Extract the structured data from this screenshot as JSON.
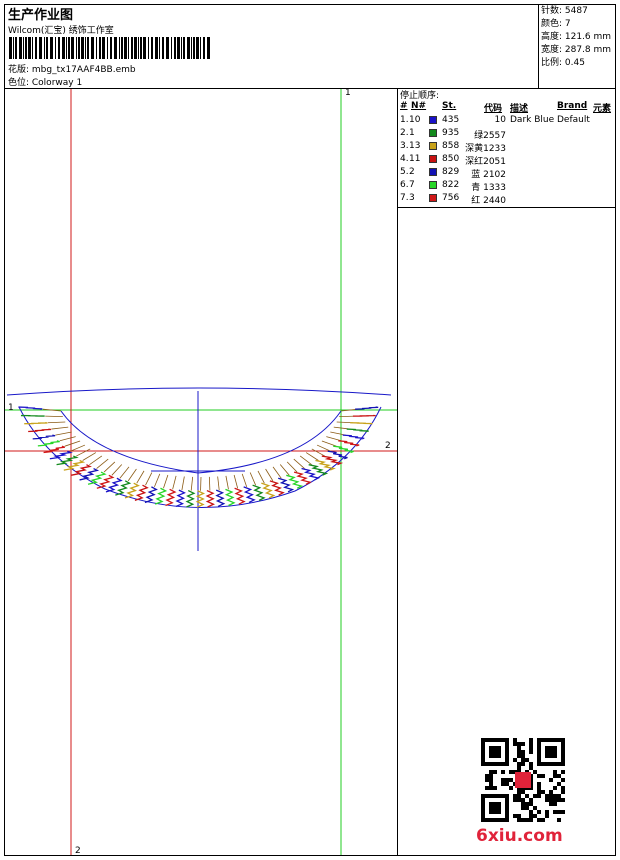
{
  "header": {
    "title": "生产作业图",
    "company": "Wilcom(汇宝) 绣饰工作室",
    "design_label": "花版: mbg_tx17AAF4BB.emb",
    "colorway_label": "色位:  Colorway 1"
  },
  "stats": {
    "stitches": "针数: 5487",
    "colors": "颜色: 7",
    "height": "高度: 121.6 mm",
    "width": "宽度: 287.8 mm",
    "scale": "比例: 0.45"
  },
  "legend": {
    "title": "停止顺序:",
    "headers": {
      "num": "#",
      "needle": "N#",
      "st": "St.",
      "code": "代码",
      "desc": "描述",
      "brand": "Brand",
      "element": "元素"
    },
    "rows": [
      {
        "num": "1.",
        "needle": "10",
        "color": "#1a12c8",
        "st": "435",
        "code": "10",
        "desc": "Dark Blue",
        "brand": "Default"
      },
      {
        "num": "2.",
        "needle": "1",
        "color": "#12891c",
        "st": "935",
        "code": "绿2557",
        "desc": "",
        "brand": ""
      },
      {
        "num": "3.",
        "needle": "13",
        "color": "#c8a21a",
        "st": "858",
        "code": "深黄1233",
        "desc": "",
        "brand": ""
      },
      {
        "num": "4.",
        "needle": "11",
        "color": "#c81212",
        "st": "850",
        "code": "深红2051",
        "desc": "",
        "brand": ""
      },
      {
        "num": "5.",
        "needle": "2",
        "color": "#1212b4",
        "st": "829",
        "code": "蓝 2102",
        "desc": "",
        "brand": ""
      },
      {
        "num": "6.",
        "needle": "7",
        "color": "#28d628",
        "st": "822",
        "code": "青 1333",
        "desc": "",
        "brand": ""
      },
      {
        "num": "7.",
        "needle": "3",
        "color": "#d01818",
        "st": "756",
        "code": "红 2440",
        "desc": "",
        "brand": ""
      }
    ]
  },
  "guides": {
    "green_top": "1",
    "green_left": "1",
    "red_right": "2",
    "red_bottom": "2"
  },
  "watermark": "6xiu.com",
  "colors": {
    "guide_green": "#22cc22",
    "guide_red": "#d01818",
    "outline_blue": "#1818c8"
  }
}
